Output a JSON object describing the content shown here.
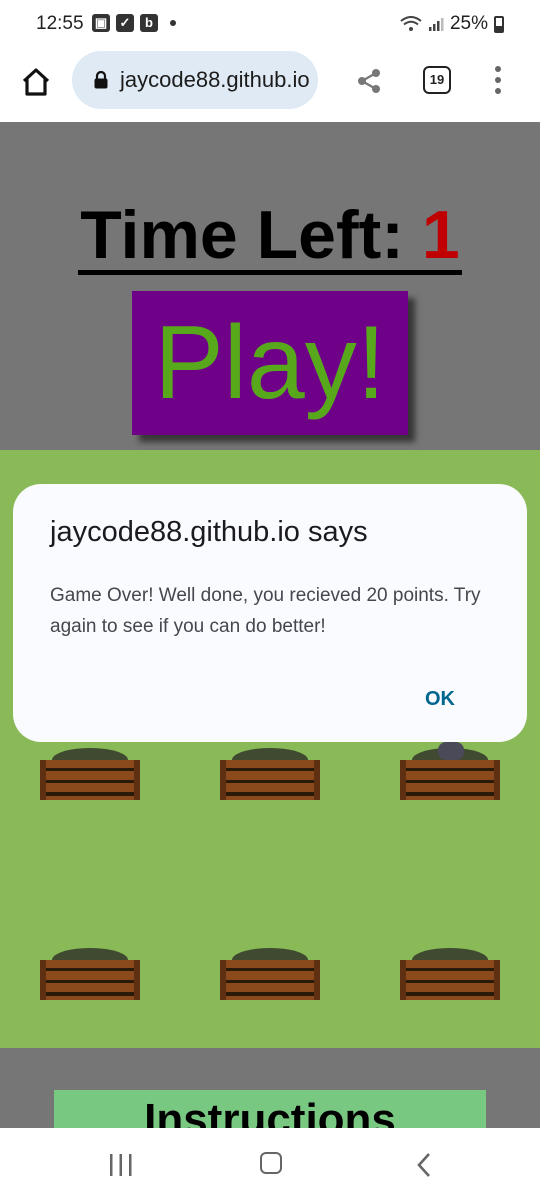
{
  "status_bar": {
    "time": "12:55",
    "notif_icons": [
      "image-icon",
      "check-icon",
      "b-icon"
    ],
    "b_letter": "b",
    "battery": "25%"
  },
  "browser": {
    "url": "jaycode88.github.io",
    "tab_count": "19"
  },
  "game": {
    "time_left_label": "Time Left:",
    "time_left_value": "1",
    "play_label": "Play!",
    "instructions_title": "Instructions",
    "colors": {
      "background_dimmed": "#767676",
      "grass": "#8ab957",
      "play_bg": "#6f0088",
      "play_text": "#58a81c",
      "time_value": "#c00000",
      "instructions_bg": "#78c882"
    }
  },
  "dialog": {
    "title": "jaycode88.github.io says",
    "message": "Game Over! Well done, you recieved 20 points. Try again to see if you can do better!",
    "ok_label": "OK"
  }
}
